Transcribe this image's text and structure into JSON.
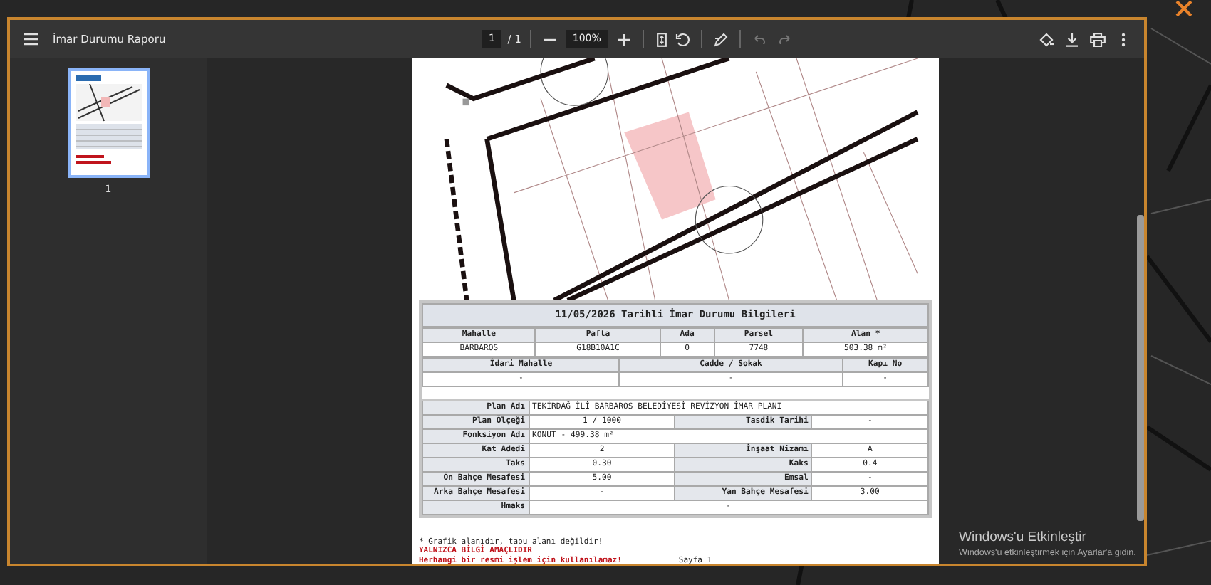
{
  "viewer": {
    "title": "İmar Durumu Raporu",
    "page_input": "1",
    "page_total": "/ 1",
    "zoom": "100%",
    "undo": {
      "disabled": true
    },
    "redo": {
      "disabled": true
    }
  },
  "thumbnails": [
    {
      "label": "1",
      "selected": true
    }
  ],
  "document": {
    "heading": "11/05/2026 Tarihli İmar Durumu Bilgileri",
    "parcel_table": {
      "columns": [
        "Mahalle",
        "Pafta",
        "Ada",
        "Parsel",
        "Alan *"
      ],
      "row": [
        "BARBAROS",
        "G18B10A1C",
        "0",
        "7748",
        "503.38 m²"
      ]
    },
    "address_table": {
      "columns": [
        "İdari Mahalle",
        "Cadde / Sokak",
        "Kapı No"
      ],
      "row": [
        "-",
        "-",
        "-"
      ]
    },
    "plan_rows": [
      {
        "kind": "wide",
        "label": "Plan Adı",
        "value": "TEKİRDAĞ İLİ BARBAROS BELEDİYESİ REVİZYON İMAR PLANI"
      },
      {
        "kind": "pair",
        "label": "Plan Ölçeği",
        "value": "1 / 1000",
        "label_2": "Tasdik Tarihi",
        "value_2": "-"
      },
      {
        "kind": "wide",
        "label": "Fonksiyon Adı",
        "value": "KONUT - 499.38 m²"
      },
      {
        "kind": "pair",
        "label": "Kat Adedi",
        "value": "2",
        "label_2": "İnşaat Nizamı",
        "value_2": "A"
      },
      {
        "kind": "pair",
        "label": "Taks",
        "value": "0.30",
        "label_2": "Kaks",
        "value_2": "0.4"
      },
      {
        "kind": "pair",
        "label": "Ön Bahçe Mesafesi",
        "value": "5.00",
        "label_2": "Emsal",
        "value_2": "-"
      },
      {
        "kind": "pair",
        "label": "Arka Bahçe Mesafesi",
        "value": "-",
        "label_2": "Yan Bahçe Mesafesi",
        "value_2": "3.00"
      },
      {
        "kind": "center",
        "label": "Hmaks",
        "value": "-"
      }
    ],
    "notes": [
      {
        "kind": "normal",
        "text": "* Grafik alanıdır, tapu alanı değildir!"
      },
      {
        "kind": "warning",
        "text": "YALNIZCA BİLGİ AMAÇLIDIR"
      },
      {
        "kind": "warning",
        "text": "Herhangi bir resmi işlem için kullanılamaz!"
      }
    ],
    "page_label": "Sayfa 1"
  },
  "activation": {
    "title": "Windows'u Etkinleştir",
    "subtitle": "Windows'u etkinleştirmek için Ayarlar'a gidin."
  }
}
